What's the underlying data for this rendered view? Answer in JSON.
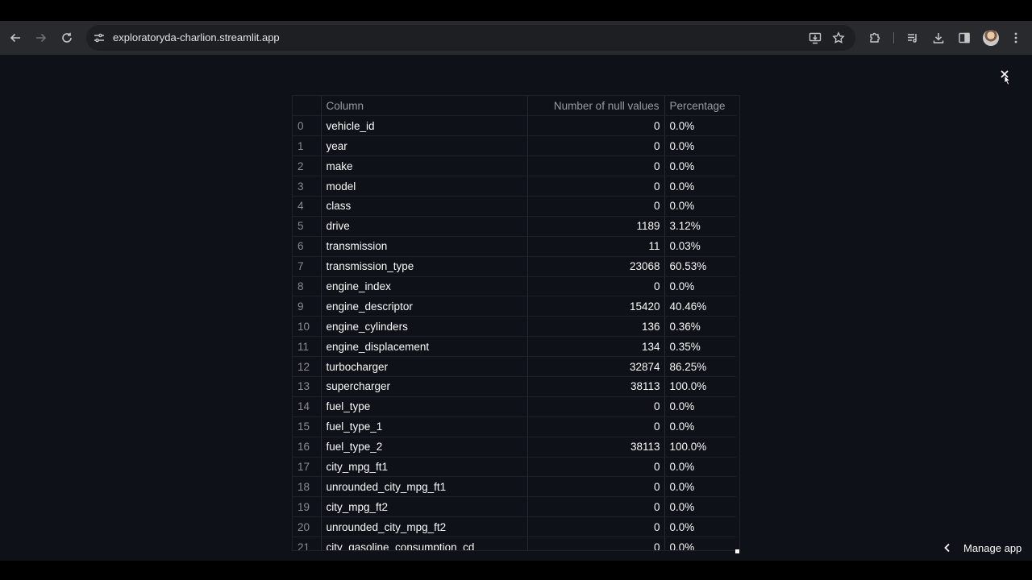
{
  "browser": {
    "url": "exploratoryda-charlion.streamlit.app"
  },
  "table": {
    "headers": {
      "column": "Column",
      "nulls": "Number of null values",
      "percentage": "Percentage"
    },
    "rows": [
      {
        "index": "0",
        "column": "vehicle_id",
        "nulls": "0",
        "percentage": "0.0%"
      },
      {
        "index": "1",
        "column": "year",
        "nulls": "0",
        "percentage": "0.0%"
      },
      {
        "index": "2",
        "column": "make",
        "nulls": "0",
        "percentage": "0.0%"
      },
      {
        "index": "3",
        "column": "model",
        "nulls": "0",
        "percentage": "0.0%"
      },
      {
        "index": "4",
        "column": "class",
        "nulls": "0",
        "percentage": "0.0%"
      },
      {
        "index": "5",
        "column": "drive",
        "nulls": "1189",
        "percentage": "3.12%"
      },
      {
        "index": "6",
        "column": "transmission",
        "nulls": "11",
        "percentage": "0.03%"
      },
      {
        "index": "7",
        "column": "transmission_type",
        "nulls": "23068",
        "percentage": "60.53%"
      },
      {
        "index": "8",
        "column": "engine_index",
        "nulls": "0",
        "percentage": "0.0%"
      },
      {
        "index": "9",
        "column": "engine_descriptor",
        "nulls": "15420",
        "percentage": "40.46%"
      },
      {
        "index": "10",
        "column": "engine_cylinders",
        "nulls": "136",
        "percentage": "0.36%"
      },
      {
        "index": "11",
        "column": "engine_displacement",
        "nulls": "134",
        "percentage": "0.35%"
      },
      {
        "index": "12",
        "column": "turbocharger",
        "nulls": "32874",
        "percentage": "86.25%"
      },
      {
        "index": "13",
        "column": "supercharger",
        "nulls": "38113",
        "percentage": "100.0%"
      },
      {
        "index": "14",
        "column": "fuel_type",
        "nulls": "0",
        "percentage": "0.0%"
      },
      {
        "index": "15",
        "column": "fuel_type_1",
        "nulls": "0",
        "percentage": "0.0%"
      },
      {
        "index": "16",
        "column": "fuel_type_2",
        "nulls": "38113",
        "percentage": "100.0%"
      },
      {
        "index": "17",
        "column": "city_mpg_ft1",
        "nulls": "0",
        "percentage": "0.0%"
      },
      {
        "index": "18",
        "column": "unrounded_city_mpg_ft1",
        "nulls": "0",
        "percentage": "0.0%"
      },
      {
        "index": "19",
        "column": "city_mpg_ft2",
        "nulls": "0",
        "percentage": "0.0%"
      },
      {
        "index": "20",
        "column": "unrounded_city_mpg_ft2",
        "nulls": "0",
        "percentage": "0.0%"
      },
      {
        "index": "21",
        "column": "city_gasoline_consumption_cd",
        "nulls": "0",
        "percentage": "0.0%"
      }
    ]
  },
  "footer": {
    "manage_app_label": "Manage app"
  },
  "icons": {
    "back": "arrow-left-icon",
    "forward": "arrow-right-icon",
    "reload": "reload-icon",
    "site_info": "tune-icon",
    "install": "install-app-icon",
    "bookmark": "star-icon",
    "extensions": "puzzle-icon",
    "media": "media-controls-icon",
    "download": "download-icon",
    "side_panel": "side-panel-icon",
    "menu": "kebab-menu-icon",
    "close": "close-icon",
    "manage_chevron": "chevron-left-icon"
  }
}
